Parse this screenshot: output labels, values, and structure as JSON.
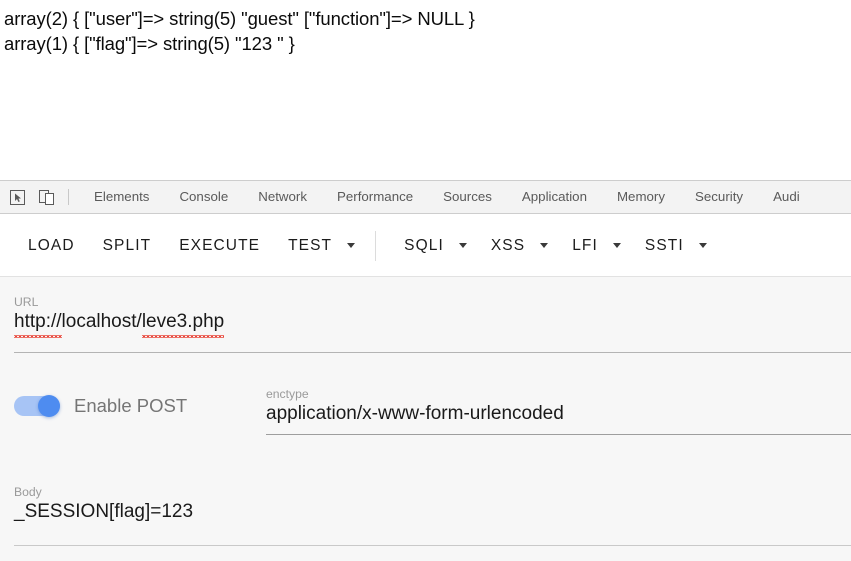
{
  "page_output": {
    "lines": [
      "array(2) { [\"user\"]=> string(5) \"guest\" [\"function\"]=> NULL }",
      "array(1) { [\"flag\"]=> string(5) \"123 \" }"
    ]
  },
  "devtools": {
    "icons": [
      {
        "name": "inspect-element-icon"
      },
      {
        "name": "device-toolbar-icon"
      }
    ],
    "tabs": [
      {
        "label": "Elements"
      },
      {
        "label": "Console"
      },
      {
        "label": "Network"
      },
      {
        "label": "Performance"
      },
      {
        "label": "Sources"
      },
      {
        "label": "Application"
      },
      {
        "label": "Memory"
      },
      {
        "label": "Security"
      },
      {
        "label": "Audi"
      }
    ]
  },
  "toolbar": {
    "plain_buttons": [
      {
        "label": "LOAD"
      },
      {
        "label": "SPLIT"
      },
      {
        "label": "EXECUTE"
      }
    ],
    "test_button": {
      "label": "TEST",
      "caret": "chevron-down-icon"
    },
    "payload_buttons": [
      {
        "label": "SQLI",
        "caret": "chevron-down-icon"
      },
      {
        "label": "XSS",
        "caret": "chevron-down-icon"
      },
      {
        "label": "LFI",
        "caret": "chevron-down-icon"
      },
      {
        "label": "SSTI",
        "caret": "chevron-down-icon"
      }
    ]
  },
  "form": {
    "url": {
      "label": "URL",
      "value_scheme": "http://",
      "value_host": "localhost",
      "value_sep": "/",
      "value_path": "leve3.php",
      "value_full": "http://localhost/leve3.php"
    },
    "post_toggle": {
      "label": "Enable POST",
      "state": "on"
    },
    "enctype": {
      "label": "enctype",
      "value": "application/x-www-form-urlencoded"
    },
    "body": {
      "label": "Body",
      "value": "_SESSION[flag]=123"
    }
  },
  "colors": {
    "accent": "#4e8cf0",
    "accent_track": "#a7c4f5",
    "panel_bg": "#f7f7f7",
    "devtools_bg": "#f3f3f3",
    "spellcheck": "#e8463a"
  }
}
